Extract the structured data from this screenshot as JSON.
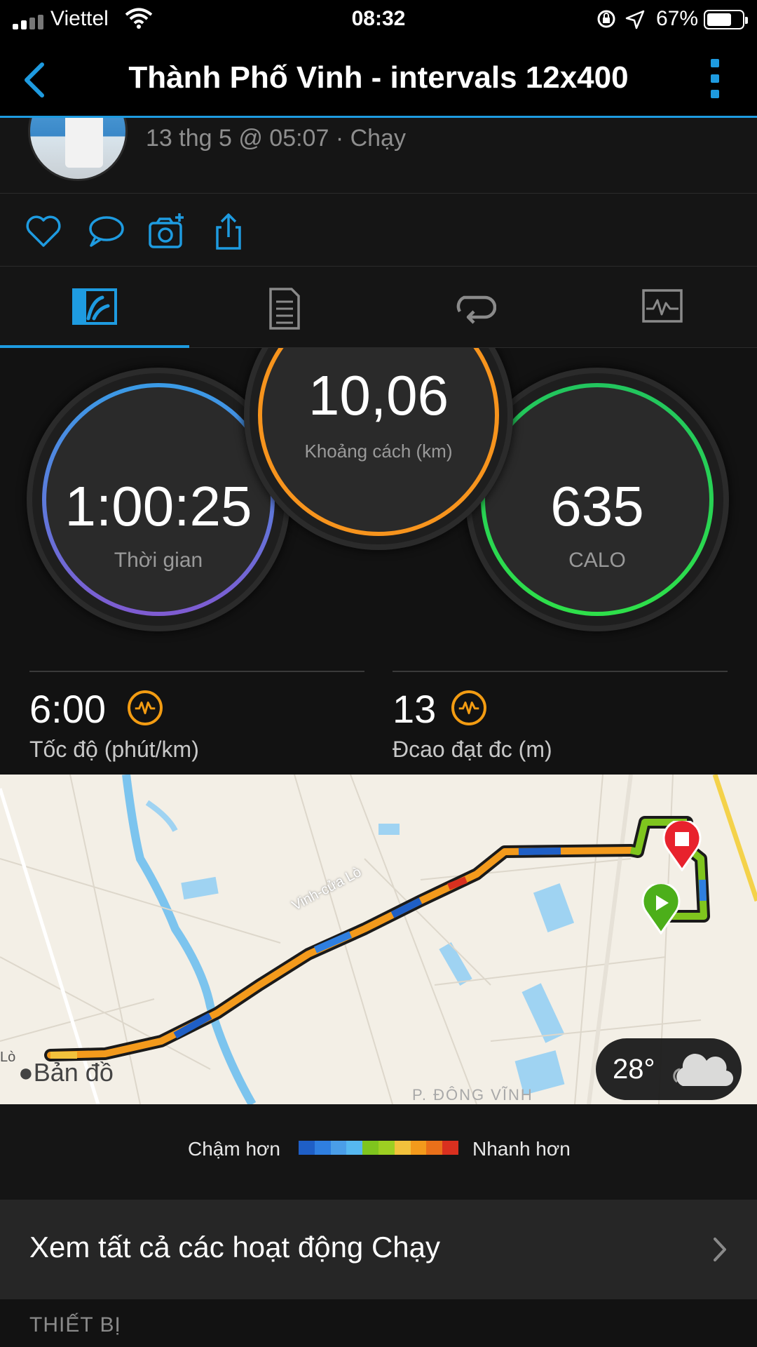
{
  "status_bar": {
    "carrier": "Viettel",
    "time": "08:32",
    "battery_percent": "67%"
  },
  "header": {
    "title": "Thành Phố Vinh - intervals 12x400"
  },
  "activity": {
    "meta": "13 thg 5 @ 05:07 · Chạy"
  },
  "tabs": [
    {
      "name": "overview",
      "icon": "overview-icon",
      "active": true
    },
    {
      "name": "details",
      "icon": "document-icon",
      "active": false
    },
    {
      "name": "laps",
      "icon": "laps-icon",
      "active": false
    },
    {
      "name": "charts",
      "icon": "chart-icon",
      "active": false
    }
  ],
  "stats": {
    "time": {
      "value": "1:00:25",
      "label": "Thời gian"
    },
    "distance": {
      "value": "10,06",
      "label": "Khoảng cách (km)"
    },
    "calories": {
      "value": "635",
      "label": "CALO"
    },
    "pace": {
      "value": "6:00",
      "label": "Tốc độ (phút/km)"
    },
    "elevation": {
      "value": "13",
      "label": "Đcao đạt đc (m)"
    }
  },
  "map": {
    "road_label": "Vinh-cửa Lò",
    "place_label": "P. ĐÔNG VĨNH",
    "edge_label": "Lò",
    "attribution": "Bản đồ",
    "weather_temp": "28°"
  },
  "legend": {
    "slow_label": "Chậm hơn",
    "fast_label": "Nhanh hơn",
    "colors": [
      "#1f5fc6",
      "#2f7fe0",
      "#4a9ee8",
      "#56b8f0",
      "#7fc51e",
      "#9dcf22",
      "#f2c23c",
      "#f39a1c",
      "#e9701a",
      "#d9301f"
    ]
  },
  "list": {
    "view_all_label": "Xem tất cả các hoạt động Chạy",
    "section_label": "THIẾT BỊ"
  },
  "colors": {
    "accent": "#1e9be0",
    "distance_ring": "#f7941d",
    "calorie_ring": "#2ee04a",
    "time_ring_top": "#3a9be6",
    "time_ring_bottom": "#7f5bd1"
  }
}
